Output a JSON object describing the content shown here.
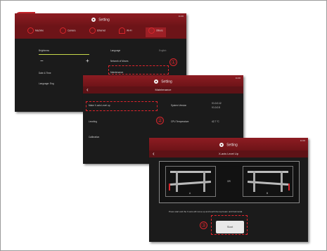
{
  "step_number": "1",
  "screen1": {
    "title": "Setting",
    "status": "11:00",
    "tabs": [
      {
        "label": "Machine"
      },
      {
        "label": "Camera"
      },
      {
        "label": "Ethernet"
      },
      {
        "label": "Wi-Fi"
      },
      {
        "label": "Others"
      }
    ],
    "left_items": {
      "brightness": "Brightness",
      "date_time": "Date & Time",
      "language": "Language: Eng"
    },
    "right_items": {
      "language": "Language",
      "language_value": "English",
      "network": "Network of Moves",
      "maintenance": "Maintenance"
    },
    "callout": "①"
  },
  "screen2": {
    "title": "Setting",
    "subtitle": "Maintenance",
    "status": "11:00",
    "items": {
      "level_up": "Make X-axis Level up",
      "leveling": "Leveling",
      "calibration": "Calibration"
    },
    "right": {
      "system_version": "System Version",
      "version_line1": "V1.0.0.12",
      "version_line2": "V1.0.0.5",
      "temp_label": "CPU Temperature",
      "temp_value": "42.7 °C"
    },
    "callout": "②"
  },
  "screen3": {
    "title": "Setting",
    "subtitle": "X-axis Level Up",
    "status": "11:00",
    "diagram": {
      "left_caption": "A",
      "right_caption": "B",
      "middle": "OR"
    },
    "instruction": "Press start and the X-axis will move up and touch the top beam until horizontal.",
    "start_label": "Start",
    "callout": "③"
  }
}
